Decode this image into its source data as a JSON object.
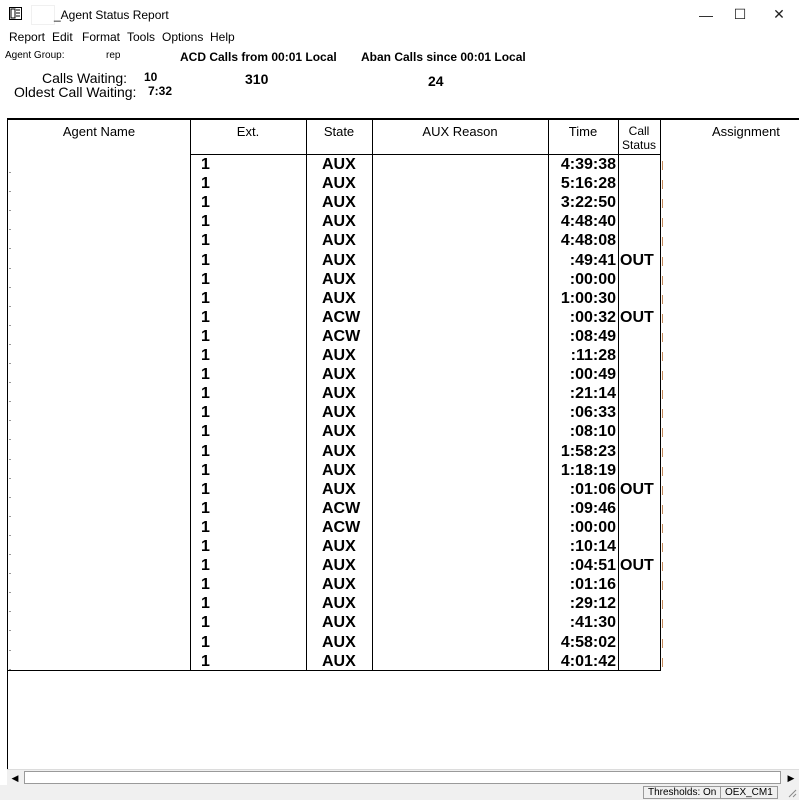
{
  "window": {
    "title": "_Agent Status Report",
    "minimize_glyph": "—",
    "maximize_glyph": "☐",
    "close_glyph": "✕"
  },
  "menu": [
    "Report",
    "Edit",
    "Format",
    "Tools",
    "Options",
    "Help"
  ],
  "header": {
    "agent_group_label": "Agent Group:",
    "agent_group_value": "rep",
    "acd_label": "ACD Calls from 00:01 Local",
    "acd_value": "310",
    "aban_label": "Aban Calls since 00:01 Local",
    "aban_value": "24",
    "calls_waiting_label": "Calls Waiting:",
    "calls_waiting_value": "10",
    "oldest_label": "Oldest Call Waiting:",
    "oldest_value": "7:32"
  },
  "table": {
    "columns": [
      "Agent Name",
      "Ext.",
      "State",
      "AUX Reason",
      "Time",
      "Call Status",
      "Assignment"
    ],
    "call_status_line1": "Call",
    "call_status_line2": "Status",
    "rows": [
      {
        "ext": "1",
        "state": "AUX",
        "time": "4:39:38",
        "call_status": ""
      },
      {
        "ext": "1",
        "state": "AUX",
        "time": "5:16:28",
        "call_status": ""
      },
      {
        "ext": "1",
        "state": "AUX",
        "time": "3:22:50",
        "call_status": ""
      },
      {
        "ext": "1",
        "state": "AUX",
        "time": "4:48:40",
        "call_status": ""
      },
      {
        "ext": "1",
        "state": "AUX",
        "time": "4:48:08",
        "call_status": ""
      },
      {
        "ext": "1",
        "state": "AUX",
        "time": ":49:41",
        "call_status": "OUT"
      },
      {
        "ext": "1",
        "state": "AUX",
        "time": ":00:00",
        "call_status": ""
      },
      {
        "ext": "1",
        "state": "AUX",
        "time": "1:00:30",
        "call_status": ""
      },
      {
        "ext": "1",
        "state": "ACW",
        "time": ":00:32",
        "call_status": "OUT"
      },
      {
        "ext": "1",
        "state": "ACW",
        "time": ":08:49",
        "call_status": ""
      },
      {
        "ext": "1",
        "state": "AUX",
        "time": ":11:28",
        "call_status": ""
      },
      {
        "ext": "1",
        "state": "AUX",
        "time": ":00:49",
        "call_status": ""
      },
      {
        "ext": "1",
        "state": "AUX",
        "time": ":21:14",
        "call_status": ""
      },
      {
        "ext": "1",
        "state": "AUX",
        "time": ":06:33",
        "call_status": ""
      },
      {
        "ext": "1",
        "state": "AUX",
        "time": ":08:10",
        "call_status": ""
      },
      {
        "ext": "1",
        "state": "AUX",
        "time": "1:58:23",
        "call_status": ""
      },
      {
        "ext": "1",
        "state": "AUX",
        "time": "1:18:19",
        "call_status": ""
      },
      {
        "ext": "1",
        "state": "AUX",
        "time": ":01:06",
        "call_status": "OUT"
      },
      {
        "ext": "1",
        "state": "ACW",
        "time": ":09:46",
        "call_status": ""
      },
      {
        "ext": "1",
        "state": "ACW",
        "time": ":00:00",
        "call_status": ""
      },
      {
        "ext": "1",
        "state": "AUX",
        "time": ":10:14",
        "call_status": ""
      },
      {
        "ext": "1",
        "state": "AUX",
        "time": ":04:51",
        "call_status": "OUT"
      },
      {
        "ext": "1",
        "state": "AUX",
        "time": ":01:16",
        "call_status": ""
      },
      {
        "ext": "1",
        "state": "AUX",
        "time": ":29:12",
        "call_status": ""
      },
      {
        "ext": "1",
        "state": "AUX",
        "time": ":41:30",
        "call_status": ""
      },
      {
        "ext": "1",
        "state": "AUX",
        "time": "4:58:02",
        "call_status": ""
      },
      {
        "ext": "1",
        "state": "AUX",
        "time": "4:01:42",
        "call_status": ""
      }
    ]
  },
  "scrollbar": {
    "left_glyph": "◀",
    "right_glyph": "▶"
  },
  "statusbar": {
    "thresholds": "Thresholds: On",
    "server": "OEX_CM1"
  }
}
